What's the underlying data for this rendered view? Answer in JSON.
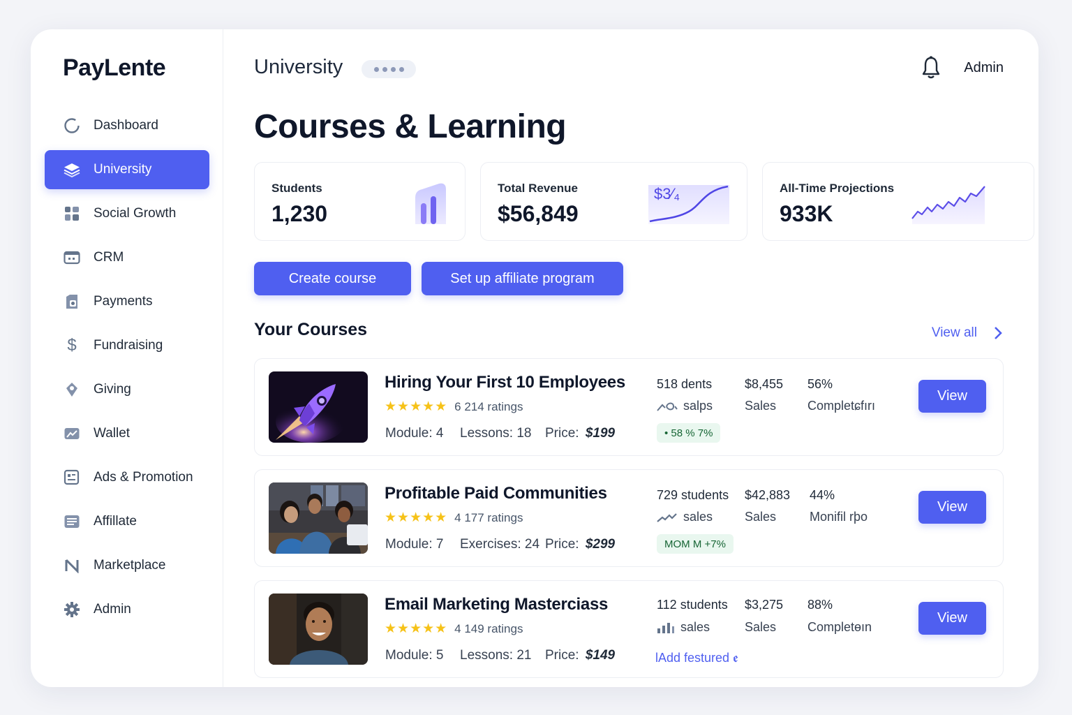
{
  "app": {
    "logo": "PayLente"
  },
  "sidebar": {
    "items": [
      {
        "label": "Dashboard",
        "icon": "circle-icon",
        "active": false
      },
      {
        "label": "University",
        "icon": "layers-icon",
        "active": true
      },
      {
        "label": "Social Growth",
        "icon": "grid-icon",
        "active": false
      },
      {
        "label": "CRM",
        "icon": "contact-card-icon",
        "active": false
      },
      {
        "label": "Payments",
        "icon": "receipt-icon",
        "active": false
      },
      {
        "label": "Fundraising",
        "icon": "dollar-icon",
        "active": false
      },
      {
        "label": "Giving",
        "icon": "tag-icon",
        "active": false
      },
      {
        "label": "Wallet",
        "icon": "wallet-icon",
        "active": false
      },
      {
        "label": "Ads & Promotion",
        "icon": "ads-icon",
        "active": false
      },
      {
        "label": "Affillate",
        "icon": "list-icon",
        "active": false
      },
      {
        "label": "Marketplace",
        "icon": "marketplace-icon",
        "active": false
      },
      {
        "label": "Admin",
        "icon": "gear-icon",
        "active": false
      }
    ]
  },
  "header": {
    "breadcrumb": "University",
    "user": "Admin"
  },
  "page": {
    "title": "Courses & Learning"
  },
  "stats": [
    {
      "label": "Students",
      "value": "1,230"
    },
    {
      "label": "Total Revenue",
      "value": "$56,849",
      "chart_label": "$3⁄₄"
    },
    {
      "label": "All-Time Projections",
      "value": "933K"
    }
  ],
  "actions": {
    "create": "Create course",
    "affiliate": "Set up affiliate program"
  },
  "courses_section": {
    "title": "Your Courses",
    "view_all": "View all"
  },
  "courses": [
    {
      "title": "Hiring Your First 10 Employees",
      "stars": "★★★★★",
      "ratings": "6 214 ratings",
      "meta1": "Module: 4",
      "meta2": "Lessons: 18",
      "price_label": "Price:",
      "price": "$199",
      "students": "518  dents",
      "students_sub": "salps",
      "sales": "$8,455",
      "sales_sub": "Sales",
      "pct": "56%",
      "pct_sub": "Completɕfırı",
      "badge": "• 58 % 7%",
      "button": "View",
      "accent": "#7c5cff"
    },
    {
      "title": "Profitable Paid Communities",
      "stars": "★★★★★",
      "ratings": "4 177 ratings",
      "meta1": "Module: 7",
      "meta2": "Exercises: 24",
      "price_label": "Price:",
      "price": "$299",
      "students": "729 students",
      "students_sub": "sales",
      "sales": "$42,883",
      "sales_sub": "Sales",
      "pct": "44%",
      "pct_sub": "Monifil rþo",
      "badge": "MOM M +7%",
      "button": "View"
    },
    {
      "title": "Email Marketing Masterciass",
      "stars": "★★★★★",
      "ratings": "4 149 ratings",
      "meta1": "Module: 5",
      "meta2": "Lessons: 21",
      "price_label": "Price:",
      "price": "$149",
      "students": "112  students",
      "students_sub": "sales",
      "sales": "$3,275",
      "sales_sub": "Sales",
      "pct": "88%",
      "pct_sub": "Completɵın",
      "feature_link": "lAdd festured ꬲ",
      "button": "View"
    }
  ],
  "colors": {
    "accent": "#4f5ff0",
    "star": "#f6c218",
    "badge_bg": "#e9f7ef"
  }
}
